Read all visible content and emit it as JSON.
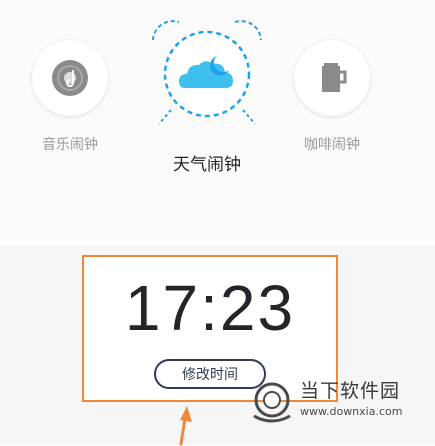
{
  "modes": [
    {
      "label": "音乐闹钟",
      "icon": "music-disc-icon"
    },
    {
      "label": "天气闹钟",
      "icon": "weather-alarm-clock-icon"
    },
    {
      "label": "咖啡闹钟",
      "icon": "coffee-cup-icon"
    }
  ],
  "alarm": {
    "time": "17:23",
    "edit_label": "修改时间"
  },
  "watermark": {
    "brand": "当下软件园",
    "url": "www.downxia.com"
  },
  "colors": {
    "highlight_border": "#f08a3a",
    "arrow": "#f08a3a",
    "weather_blue": "#1fa0e8",
    "cloud_blue": "#3dc0f0"
  }
}
